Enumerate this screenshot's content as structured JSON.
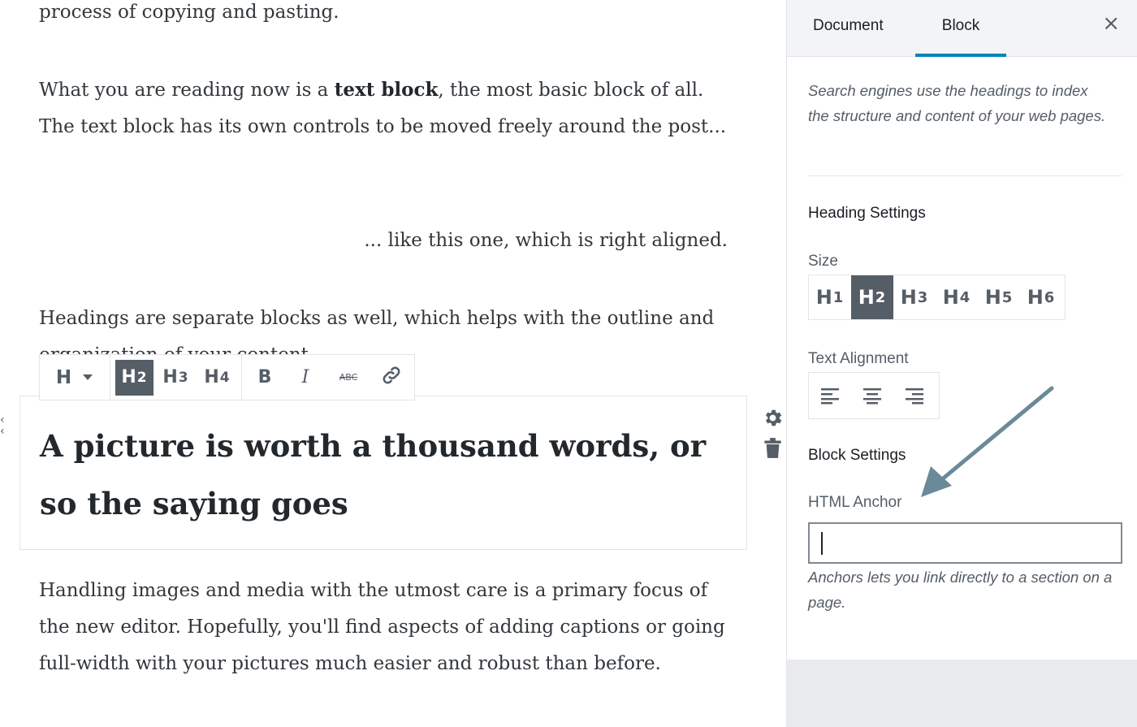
{
  "editor": {
    "para1_tail": "process of copying and pasting.",
    "para2": {
      "prefix": "What you are reading now is a ",
      "bold": "text block",
      "suffix": ", the most basic block of all. The text block has its own controls to be moved freely around the post..."
    },
    "para3": "... like this one, which is right aligned.",
    "para4": "Headings are separate blocks as well, which helps with the outline and organization of your content.",
    "heading_block": "A picture is worth a thousand words, or so the saying goes",
    "para5": "Handling images and media with the utmost care is a primary focus of the new editor. Hopefully, you'll find aspects of adding captions or going full-width with your pictures much easier and robust than before."
  },
  "toolbar": {
    "block_type": "H",
    "heading_levels": [
      {
        "letter": "H",
        "num": "2",
        "active": true
      },
      {
        "letter": "H",
        "num": "3",
        "active": false
      },
      {
        "letter": "H",
        "num": "4",
        "active": false
      }
    ],
    "bold": "B",
    "italic": "I",
    "strikethrough": "ABC"
  },
  "sidebar": {
    "tabs": [
      "Document",
      "Block"
    ],
    "active_tab": "Block",
    "close": "×",
    "help_text": "Search engines use the headings to index the structure and content of your web pages.",
    "heading_settings_title": "Heading Settings",
    "size_label": "Size",
    "sizes": [
      {
        "letter": "H",
        "num": "1",
        "active": false
      },
      {
        "letter": "H",
        "num": "2",
        "active": true
      },
      {
        "letter": "H",
        "num": "3",
        "active": false
      },
      {
        "letter": "H",
        "num": "4",
        "active": false
      },
      {
        "letter": "H",
        "num": "5",
        "active": false
      },
      {
        "letter": "H",
        "num": "6",
        "active": false
      }
    ],
    "text_alignment_label": "Text Alignment",
    "block_settings_title": "Block Settings",
    "html_anchor_label": "HTML Anchor",
    "html_anchor_value": "",
    "anchor_help": "Anchors lets you link directly to a section on a page."
  },
  "colors": {
    "accent": "#0085ba",
    "active_button": "#555d66",
    "arrow": "#6b8a99"
  },
  "icons": [
    "chevron-down-icon",
    "bold-icon",
    "italic-icon",
    "strikethrough-icon",
    "link-icon",
    "gear-icon",
    "trash-icon",
    "close-icon",
    "align-left-icon",
    "align-center-icon",
    "align-right-icon",
    "arrow-annotation-icon"
  ]
}
